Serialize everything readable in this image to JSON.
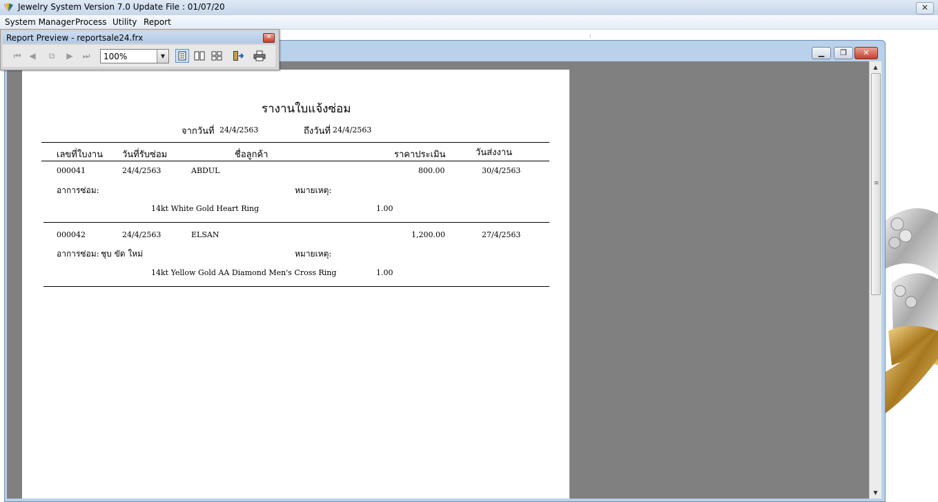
{
  "app": {
    "title": "Jewelry System Version 7.0 Update File : 01/07/20",
    "close_glyph": "✕"
  },
  "menu": [
    "System Manager",
    "Process",
    "Utility",
    "Report"
  ],
  "toolbar": {
    "title": "Report Preview - reportsale24.frx",
    "zoom": "100%",
    "icons": [
      "first-page-icon",
      "prev-page-icon",
      "goto-page-icon",
      "next-page-icon",
      "last-page-icon",
      "one-page-icon",
      "two-pages-icon",
      "four-pages-icon",
      "close-preview-icon",
      "print-icon"
    ]
  },
  "report": {
    "title": "รางานใบแจ้งซ่อม",
    "from_label": "จากวันที่",
    "from_date": "24/4/2563",
    "to_label": "ถึงวันที่",
    "to_date": "24/4/2563",
    "columns": {
      "job_no": "เลขที่ใบงาน",
      "receive_date": "วันที่รับซ่อม",
      "customer": "ชื่อลูกค้า",
      "estimate": "ราคาประเมิน",
      "delivery_date": "วันส่งงาน"
    },
    "symptom_label": "อาการซ่อม:",
    "remark_label": "หมายเหตุ:",
    "records": [
      {
        "job_no": "000041",
        "receive_date": "24/4/2563",
        "customer": "ABDUL",
        "estimate": "800.00",
        "delivery_date": "30/4/2563",
        "symptom": "",
        "remark": "",
        "item": "14kt White Gold Heart Ring",
        "qty": "1.00"
      },
      {
        "job_no": "000042",
        "receive_date": "24/4/2563",
        "customer": "ELSAN",
        "estimate": "1,200.00",
        "delivery_date": "27/4/2563",
        "symptom": "ชุบ ขัด ใหม่",
        "remark": "",
        "item": "14kt Yellow Gold AA Diamond Men's Cross Ring",
        "qty": "1.00"
      }
    ]
  },
  "colors": {
    "preview_bg": "#808080",
    "window_frame": "#b9d1ea",
    "close_red": "#c5402b"
  }
}
